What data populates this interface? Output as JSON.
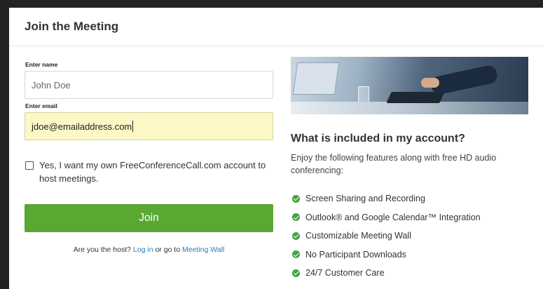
{
  "modal": {
    "title": "Join the Meeting"
  },
  "form": {
    "name_label": "Enter name",
    "name_value": "John Doe",
    "email_label": "Enter email",
    "email_value": "jdoe@emailaddress.com",
    "checkbox_label": "Yes, I want my own FreeConferenceCall.com account to host meetings.",
    "checkbox_checked": false,
    "join_label": "Join",
    "host_prefix": "Are you the host?",
    "login_link": "Log in",
    "host_middle": "or go to",
    "meeting_wall_link": "Meeting Wall"
  },
  "info": {
    "title": "What is included in my account?",
    "description": "Enjoy the following features along with free HD audio conferencing:",
    "features": [
      "Screen Sharing and Recording",
      "Outlook® and Google Calendar™ Integration",
      "Customizable Meeting Wall",
      "No Participant Downloads",
      "24/7 Customer Care"
    ],
    "check_color": "#3fa340"
  },
  "colors": {
    "join_button": "#59a832",
    "link": "#2a7ab6",
    "focused_field": "#fbf8c5"
  }
}
